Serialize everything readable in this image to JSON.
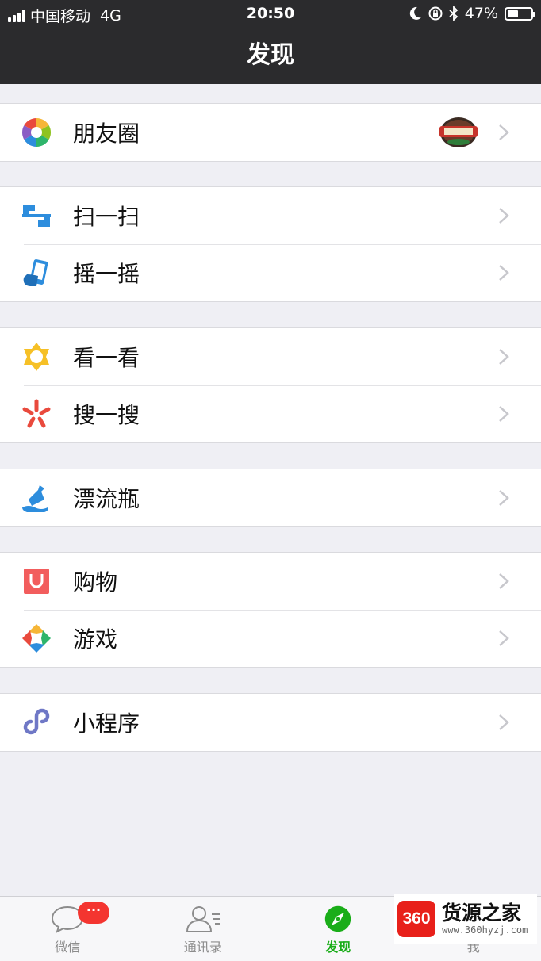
{
  "status_bar": {
    "carrier": "中国移动",
    "network": "4G",
    "time": "20:50",
    "battery": "47%",
    "battery_level": 0.47
  },
  "nav": {
    "title": "发现"
  },
  "groups": [
    {
      "items": [
        {
          "label": "朋友圈",
          "icon": "moments-icon",
          "has_thumbnail": true
        }
      ]
    },
    {
      "items": [
        {
          "label": "扫一扫",
          "icon": "scan-icon"
        },
        {
          "label": "摇一摇",
          "icon": "shake-icon"
        }
      ]
    },
    {
      "items": [
        {
          "label": "看一看",
          "icon": "top-stories-icon"
        },
        {
          "label": "搜一搜",
          "icon": "search-icon"
        }
      ]
    },
    {
      "items": [
        {
          "label": "漂流瓶",
          "icon": "drift-bottle-icon"
        }
      ]
    },
    {
      "items": [
        {
          "label": "购物",
          "icon": "shopping-icon"
        },
        {
          "label": "游戏",
          "icon": "games-icon"
        }
      ]
    },
    {
      "items": [
        {
          "label": "小程序",
          "icon": "mini-programs-icon"
        }
      ]
    }
  ],
  "tabbar": {
    "tabs": [
      {
        "label": "微信",
        "icon": "chat-bubble-icon",
        "badge": "···"
      },
      {
        "label": "通讯录",
        "icon": "contacts-icon"
      },
      {
        "label": "发现",
        "icon": "compass-icon",
        "active": true
      },
      {
        "label": "我",
        "icon": "me-icon"
      }
    ]
  },
  "watermark": {
    "logo": "360",
    "title": "货源之家",
    "url": "www.360hyzj.com"
  },
  "colors": {
    "nav_bg": "#2b2b2d",
    "page_bg": "#efeff4",
    "active_green": "#1aad19",
    "badge_red": "#f43530"
  }
}
